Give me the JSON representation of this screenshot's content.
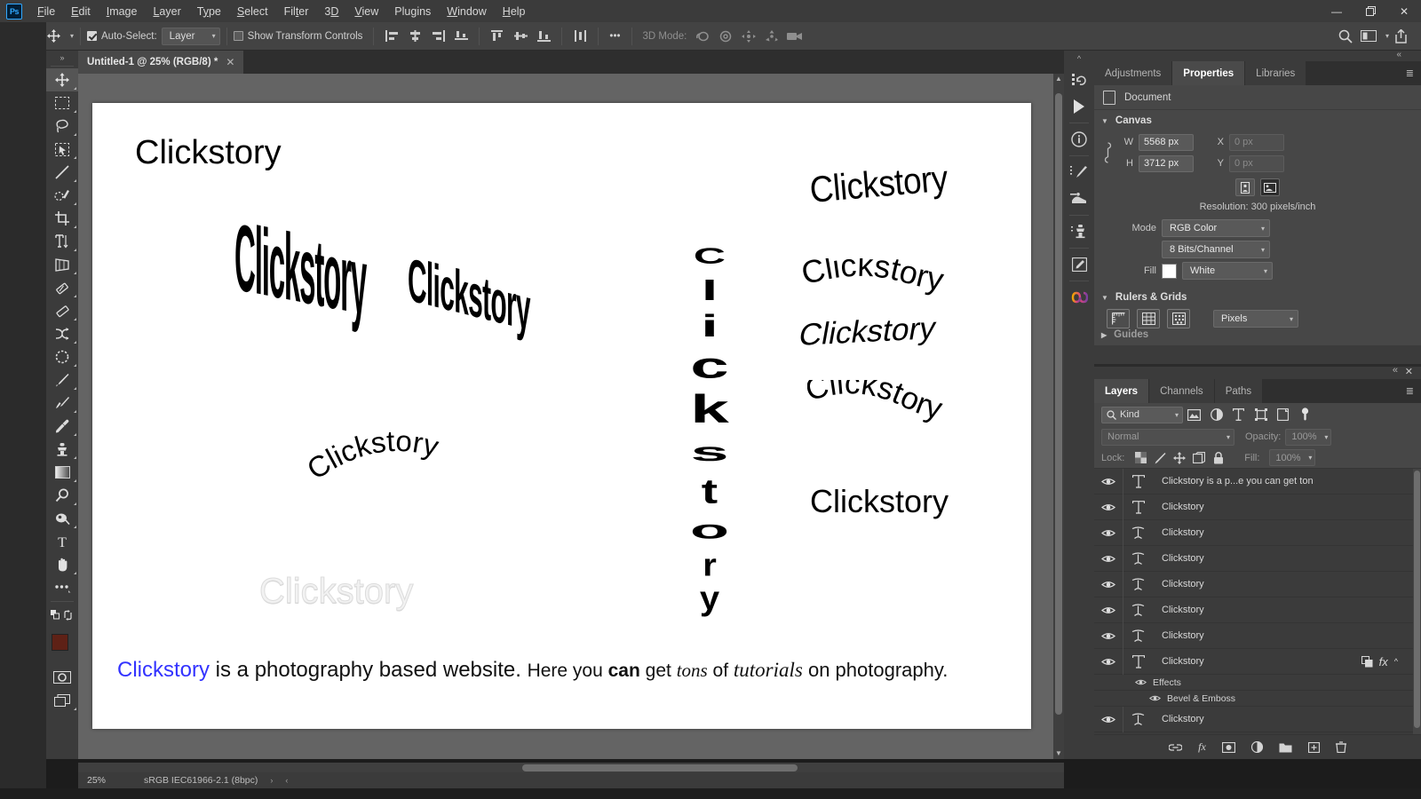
{
  "app": {
    "name": "Photoshop",
    "logo_text": "Ps"
  },
  "menubar": {
    "items": [
      "File",
      "Edit",
      "Image",
      "Layer",
      "Type",
      "Select",
      "Filter",
      "3D",
      "View",
      "Plugins",
      "Window",
      "Help"
    ],
    "window_controls": {
      "minimize": "—",
      "restore": "❐",
      "close": "✕"
    }
  },
  "options_bar": {
    "home_icon": "home-icon",
    "tool_icon": "move-tool-icon",
    "auto_select_label": "Auto-Select:",
    "auto_select_checked": true,
    "auto_select_value": "Layer",
    "show_transform_label": "Show Transform Controls",
    "show_transform_checked": false,
    "align_icons": [
      "align-left-edges",
      "align-horizontal-centers",
      "align-right-edges",
      "align-bottom-edges",
      "align-top-edges",
      "align-vertical-centers",
      "align-bottom",
      "distribute"
    ],
    "more_label": "•••",
    "threed_mode_label": "3D Mode:",
    "right_icons": [
      "search-icon",
      "workspace-icon",
      "share-icon"
    ]
  },
  "toolbar": {
    "collapse_icon": "expand-right-icon",
    "tools": [
      {
        "name": "move-tool",
        "selected": true
      },
      {
        "name": "rectangular-marquee-tool",
        "selected": false
      },
      {
        "name": "lasso-tool",
        "selected": false
      },
      {
        "name": "object-selection-tool",
        "selected": false
      },
      {
        "name": "line-tool",
        "selected": false
      },
      {
        "name": "spot-healing-brush-tool",
        "selected": false
      },
      {
        "name": "crop-tool",
        "selected": false
      },
      {
        "name": "type-tool",
        "selected": false
      },
      {
        "name": "perspective-tool",
        "selected": false
      },
      {
        "name": "eraser-tool",
        "selected": false
      },
      {
        "name": "gradient-tool",
        "selected": false
      },
      {
        "name": "shuffle-tool",
        "selected": false
      },
      {
        "name": "patch-tool",
        "selected": false
      },
      {
        "name": "brush-tool",
        "selected": false
      },
      {
        "name": "mixer-brush-tool",
        "selected": false
      },
      {
        "name": "eyedropper-tool",
        "selected": false
      },
      {
        "name": "clone-stamp-tool",
        "selected": false
      },
      {
        "name": "gradient-fill-tool",
        "selected": false
      },
      {
        "name": "zoom-tool",
        "selected": false
      },
      {
        "name": "dodge-tool",
        "selected": false
      },
      {
        "name": "horizontal-type-tool",
        "selected": false
      },
      {
        "name": "hand-tool",
        "selected": false
      },
      {
        "name": "edit-toolbar-tool",
        "selected": false
      }
    ],
    "foreground_color": "#5e2116",
    "background_color": "#ffffff",
    "quick_mask_icon": "quick-mask-icon",
    "screen_mode_icon": "screen-mode-icon"
  },
  "document": {
    "tab_title": "Untitled-1 @ 25% (RGB/8) *",
    "close_icon": "✕"
  },
  "canvas": {
    "background_color": "#646464",
    "page_color": "#ffffff",
    "texts": [
      {
        "id": "plain-top-left",
        "content": "Clickstory",
        "style": "plain"
      },
      {
        "id": "fisheye-large",
        "content": "Clickstory",
        "style": "fisheye"
      },
      {
        "id": "fisheye-inverse",
        "content": "Clickstory",
        "style": "inflate-inverse"
      },
      {
        "id": "arc-lower",
        "content": "Clickstory",
        "style": "arc"
      },
      {
        "id": "vertical-wave",
        "content": "Clickstory",
        "style": "vertical"
      },
      {
        "id": "embossed-outline",
        "content": "Clickstory",
        "style": "emboss-outline"
      },
      {
        "id": "right-rise",
        "content": "Clickstory",
        "style": "rise"
      },
      {
        "id": "right-flag",
        "content": "Clickstory",
        "style": "flag"
      },
      {
        "id": "right-slant",
        "content": "Clickstory",
        "style": "slant"
      },
      {
        "id": "right-wave",
        "content": "Clickstory",
        "style": "wave"
      },
      {
        "id": "right-plain",
        "content": "Clickstory",
        "style": "plain-small"
      }
    ],
    "paragraph": {
      "link_text": "Clickstory",
      "link_color": "#3333ff",
      "segment_1": " is a photography based website. ",
      "segment_2": "Here you ",
      "bold_word": "can",
      "segment_3": " get ",
      "script_word": "tons",
      "segment_4": " of ",
      "italic_word": "tutorials",
      "segment_5": " on photography."
    }
  },
  "status_bar": {
    "zoom": "25%",
    "color_profile": "sRGB IEC61966-2.1 (8bpc)",
    "expand_icon": "›",
    "collapse_icon": "‹"
  },
  "rail": {
    "collapse_icon": "⌃",
    "icons": [
      "history-icon",
      "actions-play-icon",
      "info-icon",
      "brush-settings-icon",
      "adjustments-icon",
      "clone-source-icon",
      "notes-icon",
      "gradients-icon"
    ]
  },
  "properties_panel": {
    "tabs": [
      {
        "label": "Adjustments",
        "active": false
      },
      {
        "label": "Properties",
        "active": true
      },
      {
        "label": "Libraries",
        "active": false
      }
    ],
    "menu_icon": "panel-menu-icon",
    "header": {
      "icon": "document-icon",
      "label": "Document"
    },
    "canvas_section": {
      "title": "Canvas",
      "width_label": "W",
      "width_value": "5568 px",
      "height_label": "H",
      "height_value": "3712 px",
      "x_label": "X",
      "x_value": "0 px",
      "y_label": "Y",
      "y_value": "0 px",
      "link_icon": "link-icon",
      "orientation_portrait": "portrait-icon",
      "orientation_landscape": "landscape-icon",
      "resolution_text": "Resolution: 300 pixels/inch",
      "mode_label": "Mode",
      "mode_value": "RGB Color",
      "depth_value": "8 Bits/Channel",
      "fill_label": "Fill",
      "fill_value": "White",
      "fill_color": "#ffffff"
    },
    "rulers_section": {
      "title": "Rulers & Grids",
      "icons": [
        "ruler-icon",
        "grid-icon",
        "guides-icon"
      ],
      "units_value": "Pixels"
    }
  },
  "layers_panel": {
    "collapse_icon": "«",
    "close_icon": "✕",
    "tabs": [
      {
        "label": "Layers",
        "active": true
      },
      {
        "label": "Channels",
        "active": false
      },
      {
        "label": "Paths",
        "active": false
      }
    ],
    "filter": {
      "search_icon": "search-icon",
      "kind_label": "Kind",
      "type_icons": [
        "pixel-layer-filter-icon",
        "adjustment-layer-filter-icon",
        "type-layer-filter-icon",
        "shape-layer-filter-icon",
        "smart-object-filter-icon"
      ],
      "toggle_icon": "filter-toggle-icon"
    },
    "blend_mode": "Normal",
    "opacity_label": "Opacity:",
    "opacity_value": "100%",
    "lock_label": "Lock:",
    "lock_icons": [
      "lock-transparency-icon",
      "lock-image-icon",
      "lock-position-icon",
      "lock-artboard-icon",
      "lock-all-icon"
    ],
    "fill_label": "Fill:",
    "fill_value": "100%",
    "layers": [
      {
        "name": "Clickstory is a p...e you can get ton",
        "thumb": "T",
        "visible": true,
        "has_fx": false
      },
      {
        "name": "Clickstory",
        "thumb": "T",
        "visible": true,
        "has_fx": false
      },
      {
        "name": "Clickstory",
        "thumb": "warped-T",
        "visible": true,
        "has_fx": false
      },
      {
        "name": "Clickstory",
        "thumb": "warped-T",
        "visible": true,
        "has_fx": false
      },
      {
        "name": "Clickstory",
        "thumb": "warped-T",
        "visible": true,
        "has_fx": false
      },
      {
        "name": "Clickstory",
        "thumb": "warped-T",
        "visible": true,
        "has_fx": false
      },
      {
        "name": "Clickstory",
        "thumb": "warped-T",
        "visible": true,
        "has_fx": false
      },
      {
        "name": "Clickstory",
        "thumb": "T",
        "visible": true,
        "has_fx": true,
        "fx_icons": [
          "link-layers-icon",
          "fx-icon",
          "collapse-fx-icon"
        ],
        "effects_label": "Effects",
        "effect_items": [
          "Bevel & Emboss"
        ]
      },
      {
        "name": "Clickstory",
        "thumb": "warped-T",
        "visible": true,
        "has_fx": false
      }
    ],
    "footer_icons": [
      "link-layers-icon",
      "fx-icon",
      "add-mask-icon",
      "adjustment-layer-icon",
      "new-group-icon",
      "new-layer-icon",
      "delete-layer-icon"
    ]
  }
}
